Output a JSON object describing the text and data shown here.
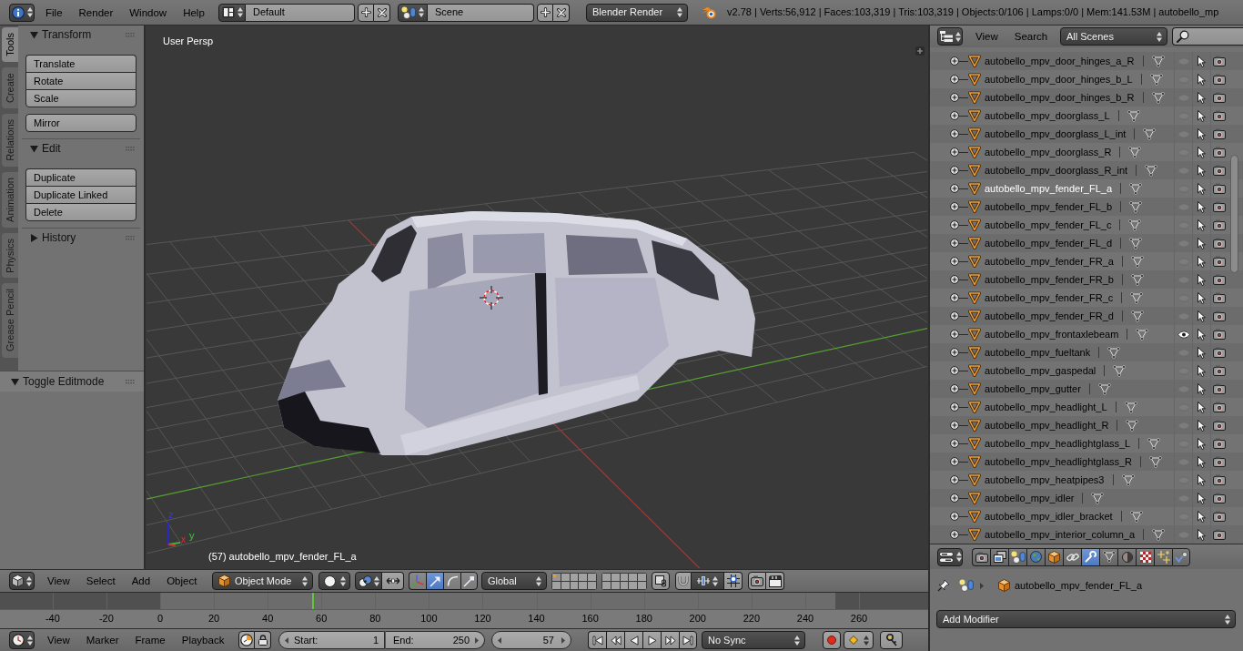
{
  "top_bar": {
    "menus": [
      "File",
      "Render",
      "Window",
      "Help"
    ],
    "screen_layout": "Default",
    "scene": "Scene",
    "render_engine": "Blender Render",
    "stats": "v2.78 | Verts:56,912 | Faces:103,319 | Tris:103,319 | Objects:0/106 | Lamps:0/0 | Mem:141.53M | autobello_mp"
  },
  "tool_shelf": {
    "tabs": [
      {
        "label": "Tools",
        "selected": true
      },
      {
        "label": "Create",
        "selected": false
      },
      {
        "label": "Relations",
        "selected": false
      },
      {
        "label": "Animation",
        "selected": false
      },
      {
        "label": "Physics",
        "selected": false
      },
      {
        "label": "Grease Pencil",
        "selected": false
      }
    ],
    "panels": [
      {
        "title": "Transform",
        "expanded": true,
        "button_groups": [
          [
            "Translate",
            "Rotate",
            "Scale"
          ],
          [
            "Mirror"
          ]
        ]
      },
      {
        "title": "Edit",
        "expanded": true,
        "button_groups": [
          [
            "Duplicate",
            "Duplicate Linked",
            "Delete"
          ]
        ]
      },
      {
        "title": "History",
        "expanded": false
      }
    ],
    "operator_panel": {
      "title": "Toggle Editmode",
      "expanded": true
    }
  },
  "viewport": {
    "view_name": "User Persp",
    "object_info": "(57) autobello_mpv_fender_FL_a",
    "axis_labels": [
      "z",
      "x",
      "y"
    ]
  },
  "view3d_header": {
    "menus": [
      "View",
      "Select",
      "Add",
      "Object"
    ],
    "mode": "Object Mode",
    "manipulators": [
      {
        "kind": "axis",
        "selected": false
      },
      {
        "kind": "translate",
        "selected": true
      },
      {
        "kind": "rotate",
        "selected": false
      },
      {
        "kind": "scale",
        "selected": false
      }
    ],
    "orientation": "Global",
    "layers": [
      {
        "selected": true
      },
      {
        "selected": false
      },
      {
        "selected": false
      },
      {
        "selected": false
      },
      {
        "selected": false
      },
      {
        "selected": false
      },
      {
        "selected": false
      },
      {
        "selected": false
      },
      {
        "selected": false
      },
      {
        "selected": false
      },
      {
        "selected": false
      },
      {
        "selected": false
      },
      {
        "selected": false
      },
      {
        "selected": false
      },
      {
        "selected": false
      },
      {
        "selected": false
      },
      {
        "selected": false
      },
      {
        "selected": false
      },
      {
        "selected": false
      },
      {
        "selected": false
      }
    ]
  },
  "timeline": {
    "ticks": [
      "-40",
      "-20",
      "0",
      "20",
      "40",
      "60",
      "80",
      "100",
      "120",
      "140",
      "160",
      "180",
      "200",
      "220",
      "240",
      "260"
    ]
  },
  "timeline_header": {
    "menus": [
      "View",
      "Marker",
      "Frame",
      "Playback"
    ],
    "start_label": "Start:",
    "start": "1",
    "end_label": "End:",
    "end": "250",
    "current_frame": "57",
    "sync": "No Sync"
  },
  "outliner": {
    "menus": [
      "View",
      "Search"
    ],
    "display_mode": "All Scenes",
    "rows": [
      {
        "name": "autobello_mpv_door_hinges_a_R",
        "selected": false,
        "highlighted": false
      },
      {
        "name": "autobello_mpv_door_hinges_b_L",
        "selected": false,
        "highlighted": false
      },
      {
        "name": "autobello_mpv_door_hinges_b_R",
        "selected": false,
        "highlighted": false
      },
      {
        "name": "autobello_mpv_doorglass_L",
        "selected": false,
        "highlighted": false
      },
      {
        "name": "autobello_mpv_doorglass_L_int",
        "selected": false,
        "highlighted": false
      },
      {
        "name": "autobello_mpv_doorglass_R",
        "selected": false,
        "highlighted": false
      },
      {
        "name": "autobello_mpv_doorglass_R_int",
        "selected": false,
        "highlighted": false
      },
      {
        "name": "autobello_mpv_fender_FL_a",
        "selected": true,
        "highlighted": false
      },
      {
        "name": "autobello_mpv_fender_FL_b",
        "selected": false,
        "highlighted": false
      },
      {
        "name": "autobello_mpv_fender_FL_c",
        "selected": false,
        "highlighted": false
      },
      {
        "name": "autobello_mpv_fender_FL_d",
        "selected": false,
        "highlighted": false
      },
      {
        "name": "autobello_mpv_fender_FR_a",
        "selected": false,
        "highlighted": false
      },
      {
        "name": "autobello_mpv_fender_FR_b",
        "selected": false,
        "highlighted": false
      },
      {
        "name": "autobello_mpv_fender_FR_c",
        "selected": false,
        "highlighted": false
      },
      {
        "name": "autobello_mpv_fender_FR_d",
        "selected": false,
        "highlighted": false
      },
      {
        "name": "autobello_mpv_frontaxlebeam",
        "selected": false,
        "highlighted": true
      },
      {
        "name": "autobello_mpv_fueltank",
        "selected": false,
        "highlighted": false
      },
      {
        "name": "autobello_mpv_gaspedal",
        "selected": false,
        "highlighted": false
      },
      {
        "name": "autobello_mpv_gutter",
        "selected": false,
        "highlighted": false
      },
      {
        "name": "autobello_mpv_headlight_L",
        "selected": false,
        "highlighted": false
      },
      {
        "name": "autobello_mpv_headlight_R",
        "selected": false,
        "highlighted": false
      },
      {
        "name": "autobello_mpv_headlightglass_L",
        "selected": false,
        "highlighted": false
      },
      {
        "name": "autobello_mpv_headlightglass_R",
        "selected": false,
        "highlighted": false
      },
      {
        "name": "autobello_mpv_heatpipes3",
        "selected": false,
        "highlighted": false
      },
      {
        "name": "autobello_mpv_idler",
        "selected": false,
        "highlighted": false
      },
      {
        "name": "autobello_mpv_idler_bracket",
        "selected": false,
        "highlighted": false
      },
      {
        "name": "autobello_mpv_interior_column_a",
        "selected": false,
        "highlighted": false
      }
    ]
  },
  "properties": {
    "tabs": [
      {
        "kind": "render",
        "selected": false
      },
      {
        "kind": "render_layers",
        "selected": false
      },
      {
        "kind": "scene",
        "selected": false
      },
      {
        "kind": "world",
        "selected": false
      },
      {
        "kind": "object",
        "selected": false
      },
      {
        "kind": "constraints",
        "selected": false
      },
      {
        "kind": "modifiers",
        "selected": true
      },
      {
        "kind": "data",
        "selected": false
      },
      {
        "kind": "material",
        "selected": false
      },
      {
        "kind": "texture",
        "selected": false
      },
      {
        "kind": "particles",
        "selected": false
      },
      {
        "kind": "physics",
        "selected": false
      }
    ],
    "object_name": "autobello_mpv_fender_FL_a",
    "add_modifier": "Add Modifier"
  }
}
